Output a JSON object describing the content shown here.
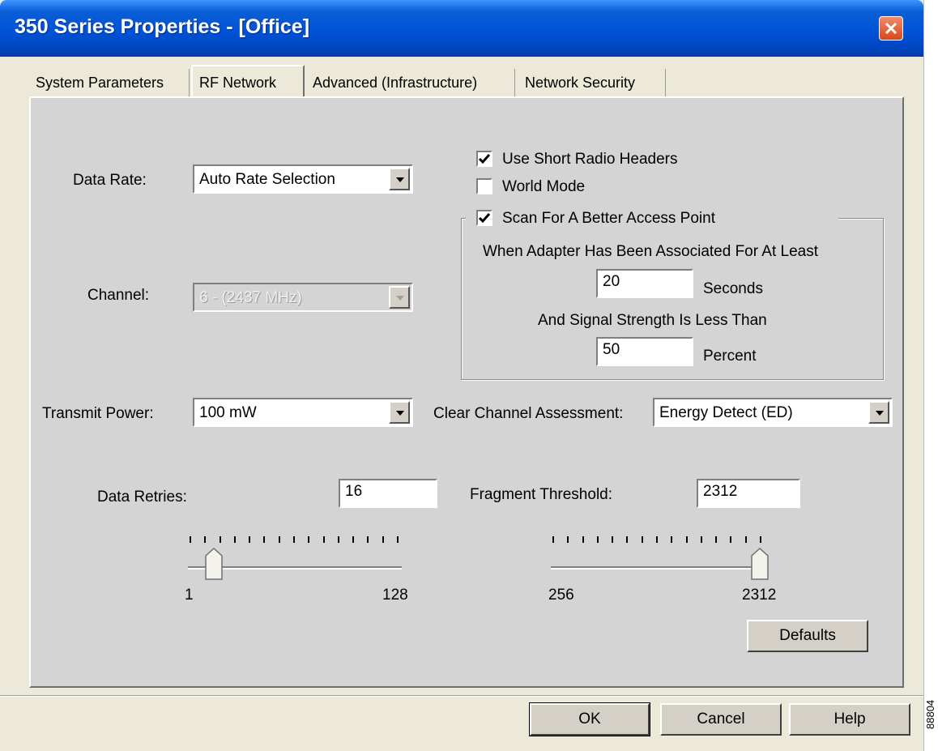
{
  "window": {
    "title": "350 Series Properties - [Office]"
  },
  "tabs": [
    {
      "label": "System Parameters",
      "active": false
    },
    {
      "label": "RF Network",
      "active": true
    },
    {
      "label": "Advanced (Infrastructure)",
      "active": false
    },
    {
      "label": "Network Security",
      "active": false
    }
  ],
  "data_rate": {
    "label": "Data Rate:",
    "value": "Auto Rate Selection"
  },
  "channel": {
    "label": "Channel:",
    "value": "6 - (2437 MHz)",
    "disabled": true
  },
  "options": {
    "short_radio_headers": {
      "label": "Use Short Radio Headers",
      "checked": true
    },
    "world_mode": {
      "label": "World Mode",
      "checked": false
    },
    "scan_better_ap": {
      "label": "Scan For A Better Access Point",
      "checked": true
    }
  },
  "scan": {
    "associated_label": "When Adapter Has Been Associated For At Least",
    "seconds_value": "20",
    "seconds_unit": "Seconds",
    "signal_label": "And Signal Strength Is Less Than",
    "percent_value": "50",
    "percent_unit": "Percent"
  },
  "transmit_power": {
    "label": "Transmit Power:",
    "value": "100 mW"
  },
  "cca": {
    "label": "Clear Channel Assessment:",
    "value": "Energy Detect (ED)"
  },
  "data_retries": {
    "label": "Data Retries:",
    "value": "16",
    "min_label": "1",
    "max_label": "128",
    "min": 1,
    "max": 128
  },
  "fragment_threshold": {
    "label": "Fragment Threshold:",
    "value": "2312",
    "min_label": "256",
    "max_label": "2312",
    "min": 256,
    "max": 2312
  },
  "buttons": {
    "defaults": "Defaults",
    "ok": "OK",
    "cancel": "Cancel",
    "help": "Help"
  },
  "figure_number": "88804",
  "colors": {
    "titlebar": "#0053d8",
    "panel": "#d4d4d4",
    "dialog": "#ece9d8",
    "close": "#d9481c"
  }
}
